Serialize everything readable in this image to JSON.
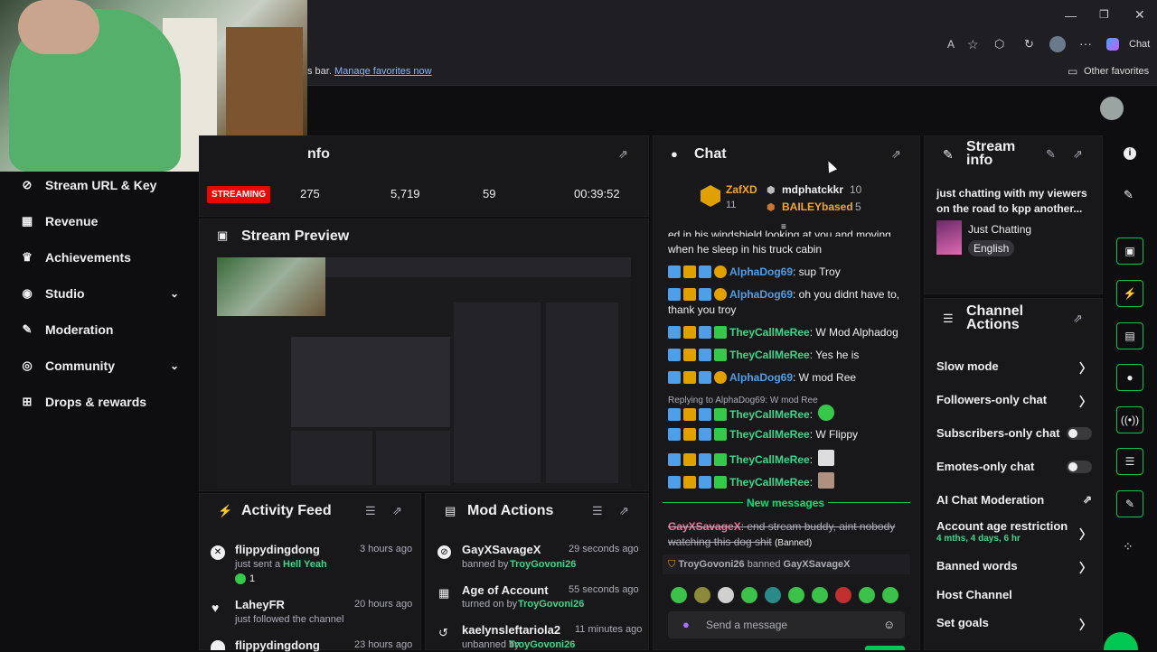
{
  "browser": {
    "chat_btn": "Chat",
    "fav_text": "s bar.",
    "fav_link": "Manage favorites now",
    "other_favorites": "Other favorites"
  },
  "sidebar": {
    "items": [
      {
        "label": "Stream URL & Key",
        "icon": "link-icon"
      },
      {
        "label": "Revenue",
        "icon": "chart-icon"
      },
      {
        "label": "Achievements",
        "icon": "trophy-icon"
      },
      {
        "label": "Studio",
        "icon": "studio-icon",
        "chevron": true
      },
      {
        "label": "Moderation",
        "icon": "wrench-icon"
      },
      {
        "label": "Community",
        "icon": "community-icon",
        "chevron": true
      },
      {
        "label": "Drops & rewards",
        "icon": "drops-icon"
      }
    ]
  },
  "info_panel": {
    "title": "nfo",
    "status": "STREAMING",
    "stats": [
      "275",
      "5,719",
      "59",
      "00:39:52"
    ]
  },
  "preview": {
    "title": "Stream Preview"
  },
  "activity": {
    "title": "Activity Feed",
    "items": [
      {
        "name": "flippydingdong",
        "sub": "just sent a",
        "highlight": "Hell Yeah",
        "count": "1",
        "time": "3 hours ago"
      },
      {
        "name": "LaheyFR",
        "sub": "just followed the channel",
        "time": "20 hours ago"
      },
      {
        "name": "flippydingdong",
        "sub": "",
        "time": "23 hours ago"
      }
    ]
  },
  "modactions": {
    "title": "Mod Actions",
    "items": [
      {
        "name": "GayXSavageX",
        "prefix": "banned by",
        "by": "TroyGovoni26",
        "time": "29 seconds ago"
      },
      {
        "name": "Age of Account",
        "prefix": "turned on by",
        "by": "TroyGovoni26",
        "time": "55 seconds ago"
      },
      {
        "name": "kaelynsleftariola2",
        "prefix": "unbanned by",
        "by": "TroyGovoni26",
        "time": "11 minutes ago"
      }
    ]
  },
  "chat": {
    "title": "Chat",
    "leaders": {
      "first_name": "ZafXD",
      "first_count": "11",
      "second_name": "mdphatckkr",
      "second_count": "10",
      "third_name": "BAILEYbased",
      "third_count": "5"
    },
    "messages": [
      {
        "text": "ed in his windshield looking at you and moving"
      },
      {
        "text": "when he sleep in his truck cabin"
      },
      {
        "user": "AlphaDog69",
        "text": ": sup Troy"
      },
      {
        "user": "AlphaDog69",
        "text": ": oh you didnt have to,"
      },
      {
        "text": "thank you troy"
      },
      {
        "user": "TheyCallMeRee",
        "text": ": W Mod Alphadog"
      },
      {
        "user": "TheyCallMeRee",
        "text": ": Yes he is"
      },
      {
        "user": "AlphaDog69",
        "text": ": W mod Ree"
      },
      {
        "reply": "Replying to AlphaDog69: W mod Ree"
      },
      {
        "user": "TheyCallMeRee",
        "text": ":"
      },
      {
        "user": "TheyCallMeRee",
        "text": ": W Flippy"
      },
      {
        "user": "TheyCallMeRee",
        "text": ":"
      },
      {
        "user": "TheyCallMeRee",
        "text": ":"
      }
    ],
    "new_messages": "New messages",
    "banned_msg_user": "GayXSavageX",
    "banned_msg_text": ": end stream buddy, aint nobody",
    "banned_msg_text2": "watching this dog shit",
    "banned_tag": "(Banned)",
    "ban_notice_user": "TroyGovoni26",
    "ban_notice_action": "banned",
    "ban_notice_target": "GayXSavageX",
    "input_placeholder": "Send a message"
  },
  "stream_info": {
    "title_1": "Stream",
    "title_2": "info",
    "desc_1": "just chatting with my viewers",
    "desc_2": "on the road to kpp another...",
    "category": "Just Chatting",
    "language": "English"
  },
  "channel_actions": {
    "title_1": "Channel",
    "title_2": "Actions",
    "rows": [
      {
        "label": "Slow mode"
      },
      {
        "label": "Followers-only chat"
      },
      {
        "label": "Subscribers-only chat"
      },
      {
        "label": "Emotes-only chat"
      },
      {
        "label": "AI Chat Moderation"
      },
      {
        "label": "Account age restriction",
        "sub": "4 mths, 4 days, 6 hr"
      },
      {
        "label": "Banned words"
      },
      {
        "label": "Host Channel"
      },
      {
        "label": "Set goals"
      }
    ]
  },
  "colors": {
    "accent": "#00c853",
    "streaming": "#eb0400",
    "user_blue": "#4e9ee8",
    "user_green": "#3dd68c"
  }
}
